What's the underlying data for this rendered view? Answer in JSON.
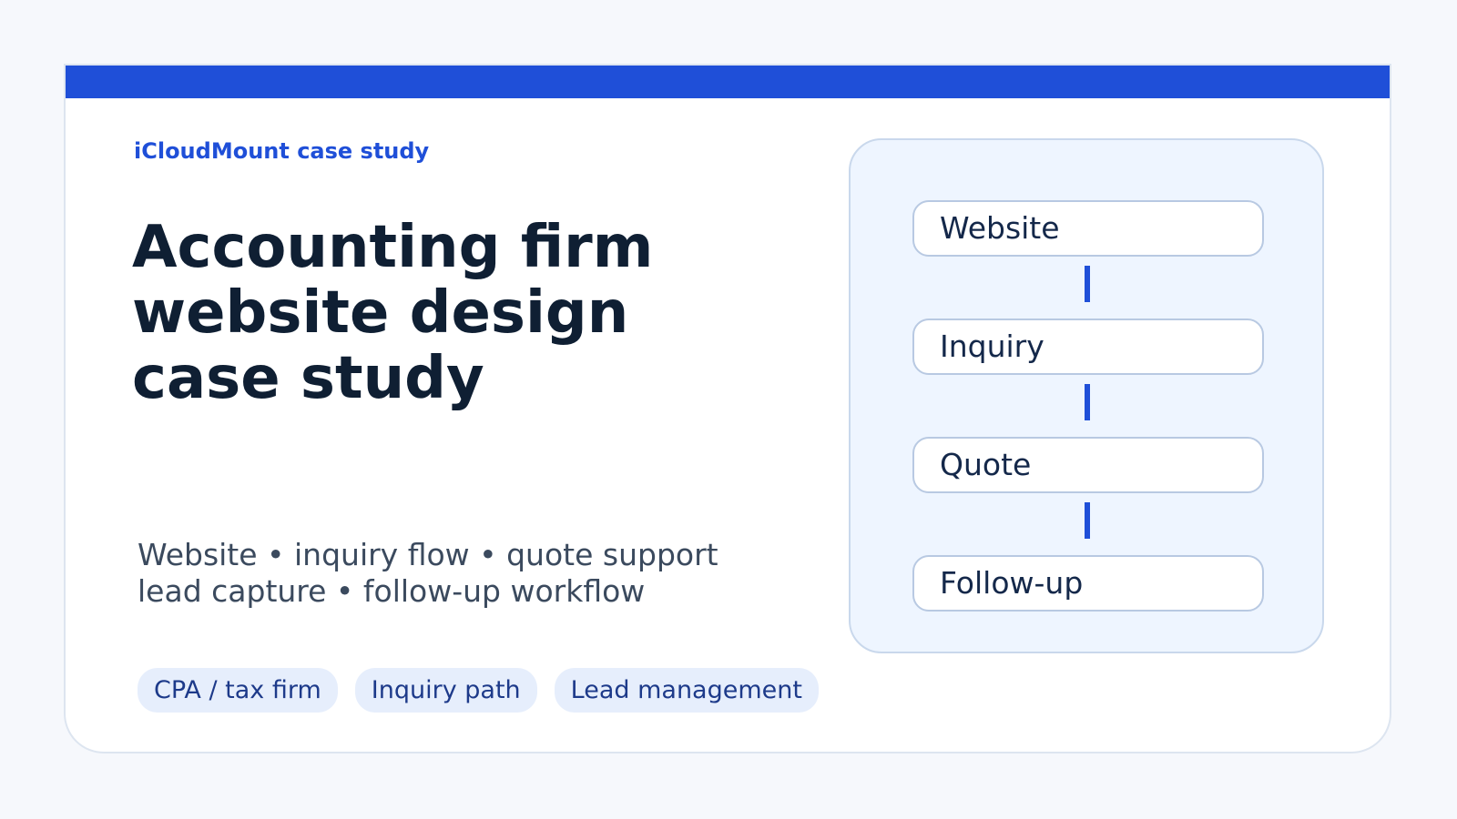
{
  "accent_color": "#1f4fd8",
  "eyebrow": "iCloudMount case study",
  "title_lines": [
    "Accounting firm",
    "website design",
    "case study"
  ],
  "subtitle_lines": [
    "Website • inquiry flow • quote support",
    "lead capture • follow-up workflow"
  ],
  "tags": [
    "CPA / tax firm",
    "Inquiry path",
    "Lead management"
  ],
  "flow": {
    "steps": [
      "Website",
      "Inquiry",
      "Quote",
      "Follow-up"
    ]
  }
}
